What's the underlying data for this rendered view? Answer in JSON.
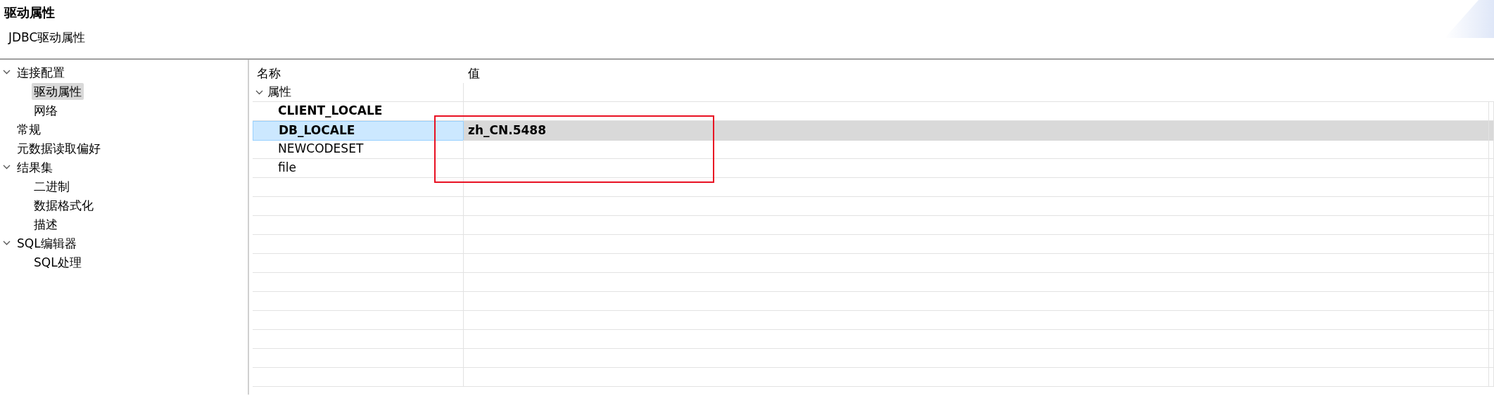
{
  "header": {
    "title": "驱动属性",
    "subtitle": "JDBC驱动属性"
  },
  "sidebar": {
    "items": [
      {
        "label": "连接配置",
        "expanded": true,
        "selected": false,
        "children": [
          {
            "label": "驱动属性",
            "selected": true
          },
          {
            "label": "网络",
            "selected": false
          }
        ]
      },
      {
        "label": "常规",
        "selected": false
      },
      {
        "label": "元数据读取偏好",
        "selected": false
      },
      {
        "label": "结果集",
        "expanded": true,
        "selected": false,
        "children": [
          {
            "label": "二进制",
            "selected": false
          },
          {
            "label": "数据格式化",
            "selected": false
          },
          {
            "label": "描述",
            "selected": false
          }
        ]
      },
      {
        "label": "SQL编辑器",
        "expanded": true,
        "selected": false,
        "children": [
          {
            "label": "SQL处理",
            "selected": false
          }
        ]
      }
    ]
  },
  "table": {
    "columns": [
      "名称",
      "值"
    ],
    "group": {
      "label": "属性",
      "expanded": true
    },
    "rows": [
      {
        "name": "CLIENT_LOCALE",
        "value": "",
        "bold": true,
        "selected": false
      },
      {
        "name": "DB_LOCALE",
        "value": "zh_CN.5488",
        "bold": true,
        "selected": true
      },
      {
        "name": "NEWCODESET",
        "value": "",
        "bold": false,
        "selected": false
      },
      {
        "name": "file",
        "value": "",
        "bold": false,
        "selected": false
      }
    ]
  }
}
